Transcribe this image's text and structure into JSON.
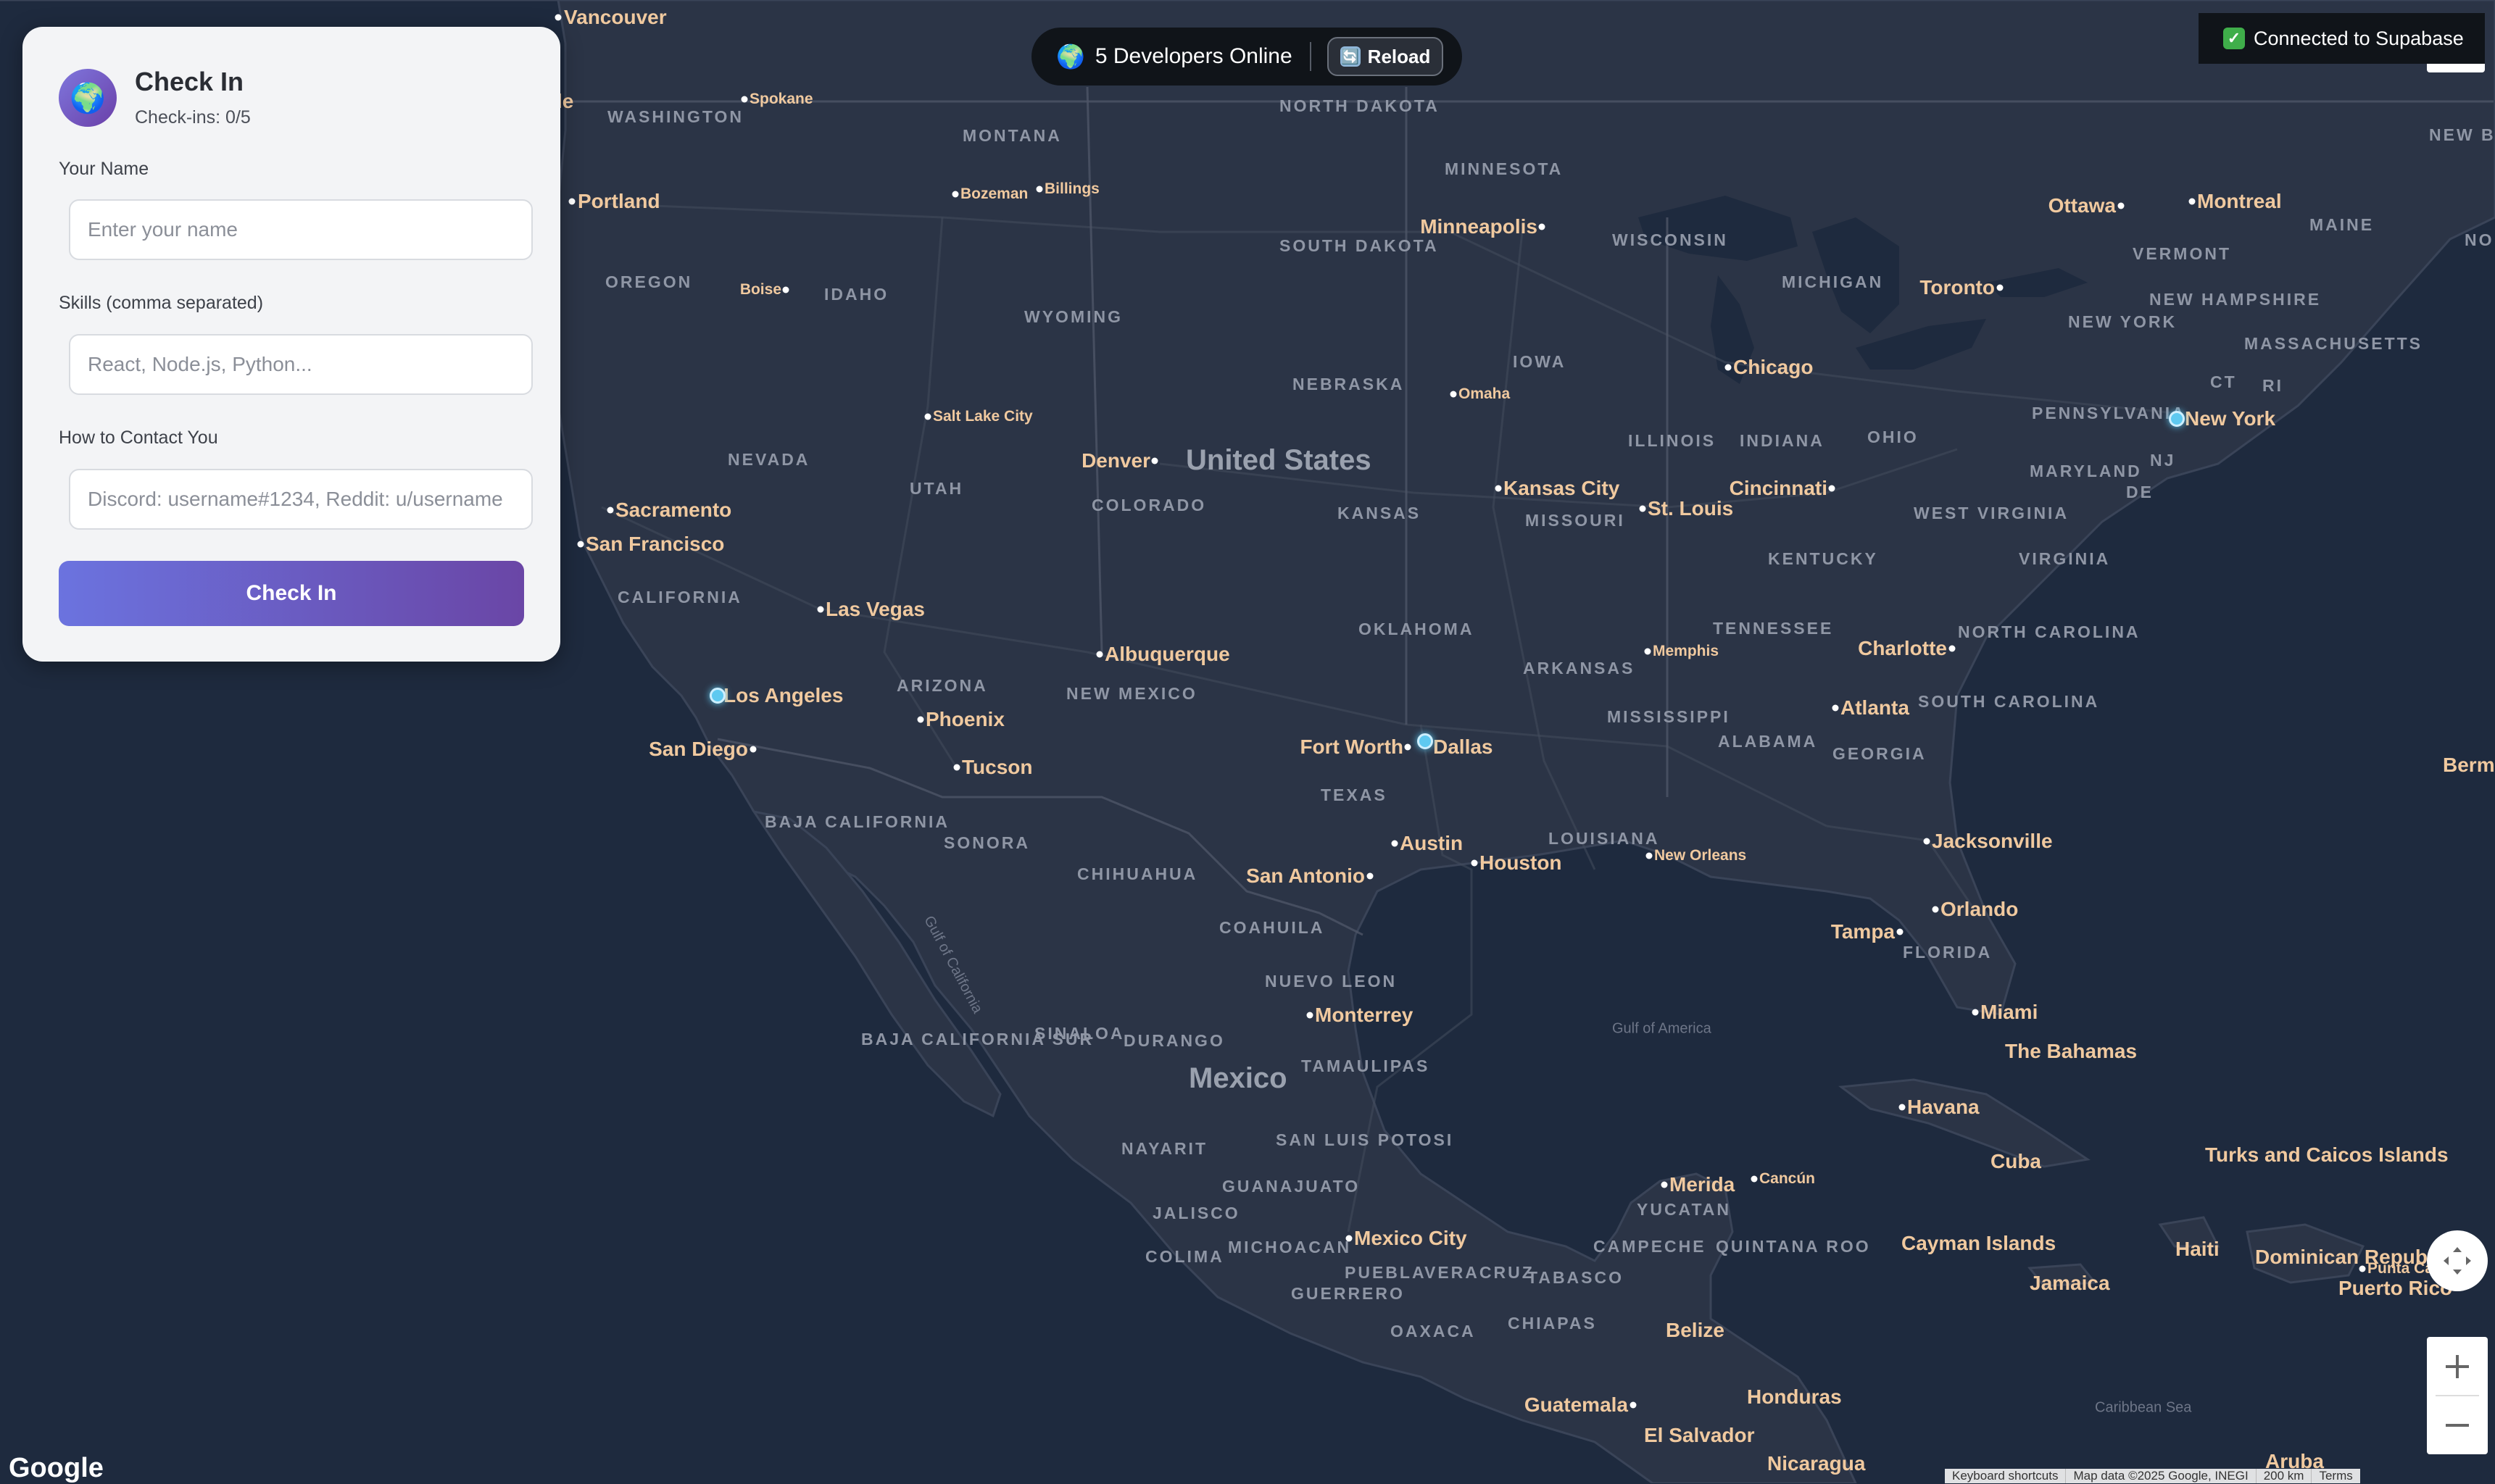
{
  "online": {
    "globe": "🌍",
    "label": "5 Developers Online"
  },
  "reload": {
    "icon": "🔄",
    "label": "Reload"
  },
  "status": {
    "icon": "✓",
    "label": "Connected to Supabase"
  },
  "panel": {
    "avatar": "🌍",
    "title": "Check In",
    "subtitle": "Check-ins: 0/5",
    "name_label": "Your Name",
    "name_placeholder": "Enter your name",
    "skills_label": "Skills (comma separated)",
    "skills_placeholder": "React, Node.js, Python...",
    "contact_label": "How to Contact You",
    "contact_placeholder": "Discord: username#1234, Reddit: u/username",
    "button": "Check In"
  },
  "map": {
    "countries": [
      "United States",
      "Mexico"
    ],
    "states": [
      "WASHINGTON",
      "MONTANA",
      "NORTH DAKOTA",
      "MINNESOTA",
      "OREGON",
      "IDAHO",
      "SOUTH DAKOTA",
      "WISCONSIN",
      "MICHIGAN",
      "WYOMING",
      "IOWA",
      "NEBRASKA",
      "NEVADA",
      "UTAH",
      "COLORADO",
      "KANSAS",
      "ILLINOIS",
      "INDIANA",
      "OHIO",
      "PENNSYLVANIA",
      "MISSOURI",
      "CALIFORNIA",
      "WEST VIRGINIA",
      "VIRGINIA",
      "KENTUCKY",
      "OKLAHOMA",
      "ARIZONA",
      "NEW MEXICO",
      "ARKANSAS",
      "TENNESSEE",
      "NORTH CAROLINA",
      "SOUTH CAROLINA",
      "MISSISSIPPI",
      "ALABAMA",
      "GEORGIA",
      "TEXAS",
      "LOUISIANA",
      "FLORIDA",
      "BAJA CALIFORNIA",
      "SONORA",
      "CHIHUAHUA",
      "COAHUILA",
      "NUEVO LEON",
      "BAJA CALIFORNIA SUR",
      "SINALOA",
      "DURANGO",
      "TAMAULIPAS",
      "SAN LUIS POTOSI",
      "NAYARIT",
      "GUANAJUATO",
      "JALISCO",
      "COLIMA",
      "MICHOACAN",
      "PUEBLA",
      "VERACRUZ",
      "GUERRERO",
      "OAXACA",
      "CHIAPAS",
      "TABASCO",
      "CAMPECHE",
      "YUCATAN",
      "QUINTANA ROO",
      "NEW YORK",
      "VERMONT",
      "NEW HAMPSHIRE",
      "MAINE",
      "MASSACHUSETTS",
      "CT",
      "RI",
      "NJ",
      "DE",
      "MARYLAND",
      "NEW BRUNSWICK",
      "NO"
    ],
    "cities": [
      "Vancouver",
      "Spokane",
      "Portland",
      "Bozeman",
      "Billings",
      "Boise",
      "Minneapolis",
      "Ottawa",
      "Montreal",
      "Toronto",
      "Chicago",
      "Omaha",
      "Salt Lake City",
      "Denver",
      "Kansas City",
      "St. Louis",
      "Cincinnati",
      "New York",
      "Sacramento",
      "San Francisco",
      "Las Vegas",
      "Albuquerque",
      "Memphis",
      "Charlotte",
      "Atlanta",
      "Los Angeles",
      "Phoenix",
      "San Diego",
      "Tucson",
      "Fort Worth",
      "Dallas",
      "Austin",
      "Houston",
      "San Antonio",
      "New Orleans",
      "Jacksonville",
      "Orlando",
      "Tampa",
      "Miami",
      "Monterrey",
      "Havana",
      "Merida",
      "Cancún",
      "Mexico City",
      "Guatemala",
      "Belize",
      "Honduras",
      "El Salvador",
      "Nicaragua",
      "Cuba",
      "Jamaica",
      "Haiti",
      "Dominican Republic",
      "Puerto Rico",
      "Punta Cana",
      "Turks and Caicos Islands",
      "Cayman Islands",
      "The Bahamas",
      "Aruba",
      "Berm",
      "le"
    ],
    "waters": [
      "Gulf of California",
      "Gulf of America",
      "Caribbean Sea"
    ],
    "google": "Google",
    "attribution": [
      "Keyboard shortcuts",
      "Map data ©2025 Google, INEGI",
      "200 km",
      "Terms"
    ]
  }
}
